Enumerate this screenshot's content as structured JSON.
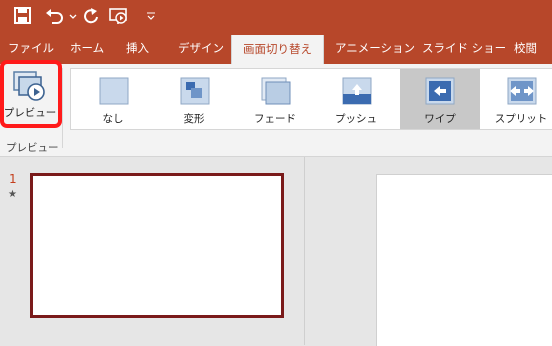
{
  "qat": {
    "icons": [
      "save-icon",
      "undo-icon",
      "redo-icon",
      "start-slideshow-icon",
      "customize-qat-icon"
    ]
  },
  "tabs": [
    {
      "label": "ファイル"
    },
    {
      "label": "ホーム"
    },
    {
      "label": "挿入"
    },
    {
      "label": "デザイン"
    },
    {
      "label": "画面切り替え",
      "active": true
    },
    {
      "label": "アニメーション"
    },
    {
      "label": "スライド ショー"
    },
    {
      "label": "校閲"
    }
  ],
  "ribbon": {
    "preview_label": "プレビュー",
    "preview_group_label": "プレビュー",
    "transitions": [
      {
        "label": "なし"
      },
      {
        "label": "変形"
      },
      {
        "label": "フェード"
      },
      {
        "label": "プッシュ"
      },
      {
        "label": "ワイプ",
        "selected": true
      },
      {
        "label": "スプリット"
      }
    ]
  },
  "slides": {
    "thumbnail_number": "1",
    "thumbnail_marker": "★"
  },
  "colors": {
    "accent": "#b7472a",
    "highlight": "#ff1a1a",
    "thumb_border": "#7a1a1a"
  }
}
